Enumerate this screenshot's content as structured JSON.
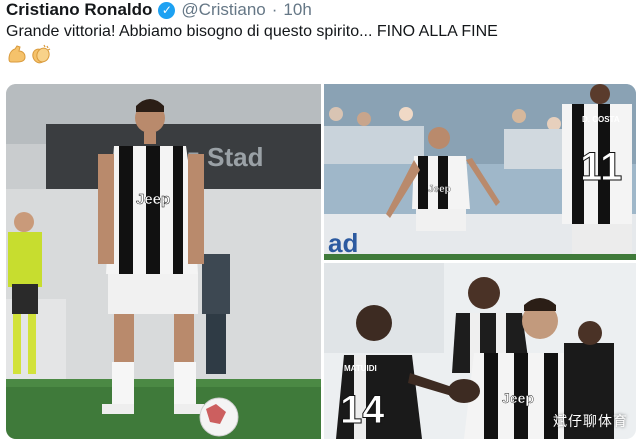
{
  "tweet": {
    "author_name": "Cristiano Ronaldo",
    "author_handle": "@Cristiano",
    "separator": "·",
    "time": "10h",
    "text": "Grande vittoria! Abbiamo bisogno di questo spirito... FINO ALLA FINE",
    "emojis": [
      "flexed-biceps",
      "clapping-hands"
    ]
  },
  "photos": {
    "main": {
      "stadium_sign": "nz Stad",
      "shirt_sponsor": "Jeep"
    },
    "top_right": {
      "board_text": "ad",
      "shirt_sponsor": "Jeep",
      "teammate_name": "D. COSTA",
      "teammate_number": "11"
    },
    "bottom_right": {
      "player_name": "MATUIDI",
      "player_number": "14",
      "shirt_sponsor": "Jeep"
    }
  },
  "watermark": "斌仔聊体育",
  "colors": {
    "verified": "#1da1f2",
    "handle": "#657786",
    "pitch": "#3f7a3a"
  }
}
